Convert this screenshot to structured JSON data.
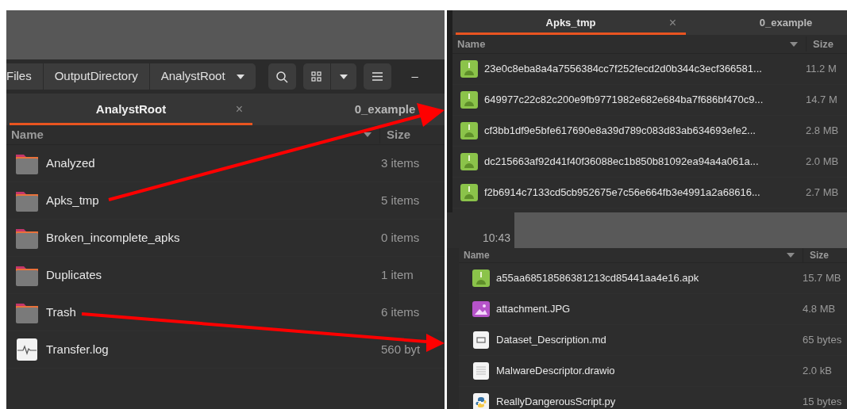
{
  "left_window": {
    "path_bar": [
      {
        "label": "Files",
        "dropdown": false
      },
      {
        "label": "OutputDirectory",
        "dropdown": false
      },
      {
        "label": "AnalystRoot",
        "dropdown": true
      }
    ],
    "minimize": "–",
    "tabs": [
      {
        "label": "AnalystRoot",
        "selected": true,
        "close": "×"
      },
      {
        "label": "0_example",
        "selected": false
      }
    ],
    "columns": [
      "Name",
      "Size"
    ],
    "rows": [
      {
        "name": "Analyzed",
        "size": "3 items",
        "kind": "folder"
      },
      {
        "name": "Apks_tmp",
        "size": "5 items",
        "kind": "folder"
      },
      {
        "name": "Broken_incomplete_apks",
        "size": "0 items",
        "kind": "folder"
      },
      {
        "name": "Duplicates",
        "size": "1 item",
        "kind": "folder"
      },
      {
        "name": "Trash",
        "size": "6 items",
        "kind": "folder"
      },
      {
        "name": "Transfer.log",
        "size": "560 byt",
        "kind": "log"
      }
    ]
  },
  "top_right_window": {
    "tabs": [
      {
        "label": "Apks_tmp",
        "selected": true,
        "close": "×"
      },
      {
        "label": "0_example",
        "selected": false
      }
    ],
    "columns": [
      "Name",
      "Size"
    ],
    "rows": [
      {
        "name": "23e0c8eba8a4a7556384cc7f252fecd2d0b344c3ecf366581...",
        "size": "11.2 M",
        "kind": "apk"
      },
      {
        "name": "649977c22c82c200e9fb9771982e682e684ba7f686bf470c9...",
        "size": "14.7 M",
        "kind": "apk"
      },
      {
        "name": "cf3bb1df9e5bfe617690e8a39d789c083d83ab634693efe2...",
        "size": "2.8 MB",
        "kind": "apk"
      },
      {
        "name": "dc215663af92d41f40f36088ec1b850b81092ea94a4a061a...",
        "size": "2.0 MB",
        "kind": "apk"
      },
      {
        "name": "f2b6914c7133cd5cb952675e7c56e664fb3e4991a2a68616...",
        "size": "2.7 MB",
        "kind": "apk"
      }
    ]
  },
  "clock": "10:43",
  "bottom_right_window": {
    "columns": [
      "Name",
      "Size"
    ],
    "rows": [
      {
        "name": "a55aa68518586381213cd85441aa4e16.apk",
        "size": "15.7 MB",
        "kind": "apk"
      },
      {
        "name": "attachment.JPG",
        "size": "4.8 MB",
        "kind": "image"
      },
      {
        "name": "Dataset_Description.md",
        "size": "65 bytes",
        "kind": "markdown"
      },
      {
        "name": "MalwareDescriptor.drawio",
        "size": "2.0 kB",
        "kind": "text"
      },
      {
        "name": "ReallyDangerousScript.py",
        "size": "15 bytes",
        "kind": "python"
      }
    ]
  }
}
